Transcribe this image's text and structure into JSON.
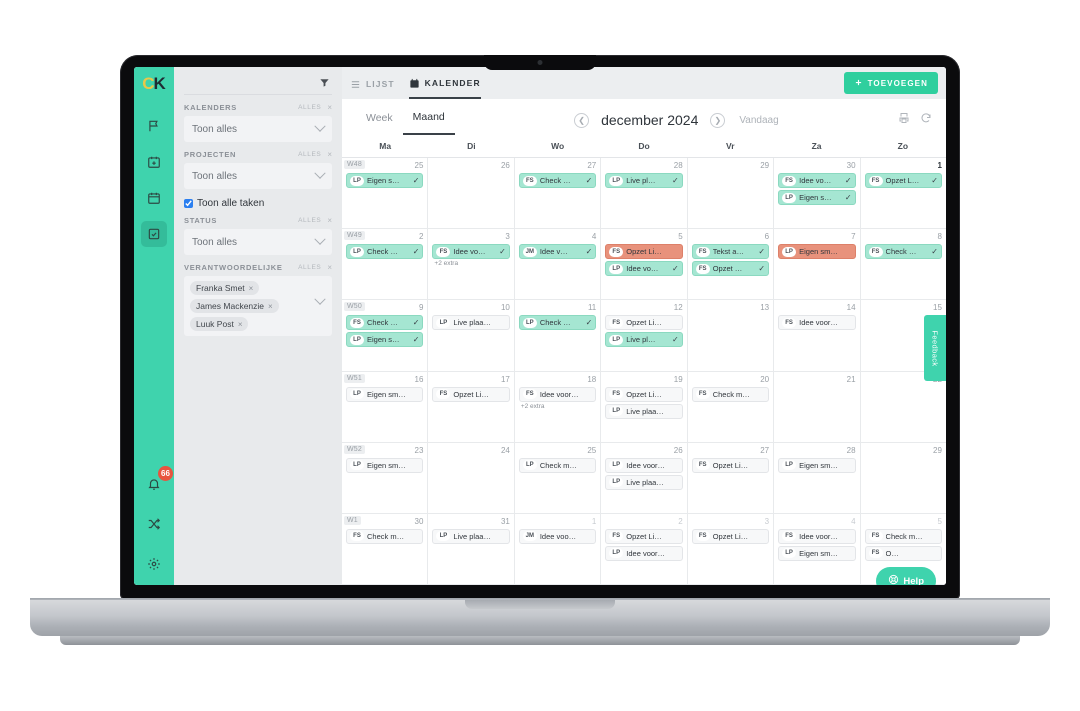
{
  "app": {
    "logo_c": "C",
    "logo_k": "K"
  },
  "rail": {
    "items": [
      {
        "name": "flag-icon",
        "label": "Vlag"
      },
      {
        "name": "calendar-plus-icon",
        "label": "Nieuwe agenda"
      },
      {
        "name": "calendar-icon",
        "label": "Agenda"
      },
      {
        "name": "checkbox-icon",
        "label": "Taken"
      }
    ],
    "bottom": [
      {
        "name": "bell-icon",
        "label": "Meldingen",
        "badge": "66"
      },
      {
        "name": "shuffle-icon",
        "label": "Wisselen"
      },
      {
        "name": "gear-icon",
        "label": "Instellingen"
      }
    ]
  },
  "filters": {
    "funnel_icon": "filter-icon",
    "groups": [
      {
        "label": "KALENDERS",
        "all": "ALLES",
        "clear": "×",
        "value": "Toon alles"
      },
      {
        "label": "PROJECTEN",
        "all": "ALLES",
        "clear": "×",
        "value": "Toon alles"
      }
    ],
    "checkbox": {
      "label": "Toon alle taken",
      "checked": true
    },
    "status": {
      "label": "STATUS",
      "all": "ALLES",
      "clear": "×",
      "value": "Toon alles"
    },
    "responsible": {
      "label": "VERANTWOORDELIJKE",
      "all": "ALLES",
      "clear": "×",
      "tags": [
        "Franka Smet",
        "James Mackenzie",
        "Luuk Post"
      ],
      "tag_remove": "×"
    }
  },
  "topbar": {
    "tabs": [
      {
        "label": "LIJST",
        "icon": "list-icon",
        "active": false
      },
      {
        "label": "KALENDER",
        "icon": "calendar-icon",
        "active": true
      }
    ],
    "add_label": "TOEVOEGEN",
    "add_icon": "plus-icon"
  },
  "calbar": {
    "views": [
      {
        "label": "Week",
        "active": false
      },
      {
        "label": "Maand",
        "active": true
      }
    ],
    "prev_icon": "chevron-left-icon",
    "next_icon": "chevron-right-icon",
    "title": "december 2024",
    "today_label": "Vandaag",
    "print_icon": "print-icon",
    "refresh_icon": "refresh-icon"
  },
  "calendar": {
    "day_headers": [
      "Ma",
      "Di",
      "Wo",
      "Do",
      "Vr",
      "Za",
      "Zo"
    ],
    "more_label": "+2 extra",
    "weeks": [
      {
        "week": "W48",
        "days": [
          {
            "num": "25",
            "dim": false,
            "bold": false,
            "events": [
              {
                "av": "LP",
                "text": "Eigen s…",
                "state": "done",
                "check": true
              }
            ]
          },
          {
            "num": "26",
            "dim": false,
            "bold": false,
            "events": []
          },
          {
            "num": "27",
            "dim": false,
            "bold": false,
            "events": [
              {
                "av": "FS",
                "text": "Check …",
                "state": "done",
                "check": true
              }
            ]
          },
          {
            "num": "28",
            "dim": false,
            "bold": false,
            "events": [
              {
                "av": "LP",
                "text": "Live pl…",
                "state": "done",
                "check": true
              }
            ]
          },
          {
            "num": "29",
            "dim": false,
            "bold": false,
            "events": []
          },
          {
            "num": "30",
            "dim": false,
            "bold": false,
            "events": [
              {
                "av": "FS",
                "text": "Idee vo…",
                "state": "done",
                "check": true
              },
              {
                "av": "LP",
                "text": "Eigen s…",
                "state": "done",
                "check": true
              }
            ]
          },
          {
            "num": "1",
            "dim": false,
            "bold": true,
            "events": [
              {
                "av": "FS",
                "text": "Opzet L…",
                "state": "done",
                "check": true
              }
            ]
          }
        ]
      },
      {
        "week": "W49",
        "days": [
          {
            "num": "2",
            "dim": false,
            "bold": false,
            "events": [
              {
                "av": "LP",
                "text": "Check …",
                "state": "done",
                "check": true
              }
            ]
          },
          {
            "num": "3",
            "dim": false,
            "bold": false,
            "more": true,
            "events": [
              {
                "av": "FS",
                "text": "Idee vo…",
                "state": "done",
                "check": true
              }
            ]
          },
          {
            "num": "4",
            "dim": false,
            "bold": false,
            "events": [
              {
                "av": "JM",
                "text": "Idee v…",
                "state": "done",
                "check": true
              }
            ]
          },
          {
            "num": "5",
            "dim": false,
            "bold": false,
            "events": [
              {
                "av": "FS",
                "text": "Opzet Li…",
                "state": "late",
                "check": false
              },
              {
                "av": "LP",
                "text": "Idee vo…",
                "state": "done",
                "check": true
              }
            ]
          },
          {
            "num": "6",
            "dim": false,
            "bold": false,
            "events": [
              {
                "av": "FS",
                "text": "Tekst a…",
                "state": "done",
                "check": true
              },
              {
                "av": "FS",
                "text": "Opzet …",
                "state": "done",
                "check": true
              }
            ]
          },
          {
            "num": "7",
            "dim": false,
            "bold": false,
            "events": [
              {
                "av": "LP",
                "text": "Eigen sm…",
                "state": "late",
                "check": false
              }
            ]
          },
          {
            "num": "8",
            "dim": false,
            "bold": false,
            "events": [
              {
                "av": "FS",
                "text": "Check …",
                "state": "done",
                "check": true
              }
            ]
          }
        ]
      },
      {
        "week": "W50",
        "days": [
          {
            "num": "9",
            "dim": false,
            "bold": false,
            "events": [
              {
                "av": "FS",
                "text": "Check …",
                "state": "done",
                "check": true
              },
              {
                "av": "LP",
                "text": "Eigen s…",
                "state": "done",
                "check": true
              }
            ]
          },
          {
            "num": "10",
            "dim": false,
            "bold": false,
            "events": [
              {
                "av": "LP",
                "text": "Live plaa…",
                "state": "open",
                "check": false
              }
            ]
          },
          {
            "num": "11",
            "dim": false,
            "bold": false,
            "events": [
              {
                "av": "LP",
                "text": "Check …",
                "state": "done",
                "check": true
              }
            ]
          },
          {
            "num": "12",
            "dim": false,
            "bold": false,
            "events": [
              {
                "av": "FS",
                "text": "Opzet Li…",
                "state": "open",
                "check": false
              },
              {
                "av": "LP",
                "text": "Live pl…",
                "state": "done",
                "check": true
              }
            ]
          },
          {
            "num": "13",
            "dim": false,
            "bold": false,
            "events": []
          },
          {
            "num": "14",
            "dim": false,
            "bold": false,
            "events": [
              {
                "av": "FS",
                "text": "Idee voor…",
                "state": "open",
                "check": false
              }
            ]
          },
          {
            "num": "15",
            "dim": false,
            "bold": false,
            "events": []
          }
        ]
      },
      {
        "week": "W51",
        "days": [
          {
            "num": "16",
            "dim": false,
            "bold": false,
            "events": [
              {
                "av": "LP",
                "text": "Eigen sm…",
                "state": "open",
                "check": false
              }
            ]
          },
          {
            "num": "17",
            "dim": false,
            "bold": false,
            "events": [
              {
                "av": "FS",
                "text": "Opzet Li…",
                "state": "open",
                "check": false
              }
            ]
          },
          {
            "num": "18",
            "dim": false,
            "bold": false,
            "more": true,
            "events": [
              {
                "av": "FS",
                "text": "Idee voor…",
                "state": "open",
                "check": false
              }
            ]
          },
          {
            "num": "19",
            "dim": false,
            "bold": false,
            "events": [
              {
                "av": "FS",
                "text": "Opzet Li…",
                "state": "open",
                "check": false
              },
              {
                "av": "LP",
                "text": "Live plaa…",
                "state": "open",
                "check": false
              }
            ]
          },
          {
            "num": "20",
            "dim": false,
            "bold": false,
            "events": [
              {
                "av": "FS",
                "text": "Check m…",
                "state": "open",
                "check": false
              }
            ]
          },
          {
            "num": "21",
            "dim": false,
            "bold": false,
            "events": []
          },
          {
            "num": "22",
            "dim": false,
            "bold": false,
            "events": []
          }
        ]
      },
      {
        "week": "W52",
        "days": [
          {
            "num": "23",
            "dim": false,
            "bold": false,
            "events": [
              {
                "av": "LP",
                "text": "Eigen sm…",
                "state": "open",
                "check": false
              }
            ]
          },
          {
            "num": "24",
            "dim": false,
            "bold": false,
            "events": []
          },
          {
            "num": "25",
            "dim": false,
            "bold": false,
            "events": [
              {
                "av": "LP",
                "text": "Check m…",
                "state": "open",
                "check": false
              }
            ]
          },
          {
            "num": "26",
            "dim": false,
            "bold": false,
            "events": [
              {
                "av": "LP",
                "text": "Idee voor…",
                "state": "open",
                "check": false
              },
              {
                "av": "LP",
                "text": "Live plaa…",
                "state": "open",
                "check": false
              }
            ]
          },
          {
            "num": "27",
            "dim": false,
            "bold": false,
            "events": [
              {
                "av": "FS",
                "text": "Opzet Li…",
                "state": "open",
                "check": false
              }
            ]
          },
          {
            "num": "28",
            "dim": false,
            "bold": false,
            "events": [
              {
                "av": "LP",
                "text": "Eigen sm…",
                "state": "open",
                "check": false
              }
            ]
          },
          {
            "num": "29",
            "dim": false,
            "bold": false,
            "events": []
          }
        ]
      },
      {
        "week": "W1",
        "days": [
          {
            "num": "30",
            "dim": false,
            "bold": false,
            "events": [
              {
                "av": "FS",
                "text": "Check m…",
                "state": "open",
                "check": false
              }
            ]
          },
          {
            "num": "31",
            "dim": false,
            "bold": false,
            "events": [
              {
                "av": "LP",
                "text": "Live plaa…",
                "state": "open",
                "check": false
              }
            ]
          },
          {
            "num": "1",
            "dim": true,
            "bold": false,
            "events": [
              {
                "av": "JM",
                "text": "Idee voo…",
                "state": "open",
                "check": false
              }
            ]
          },
          {
            "num": "2",
            "dim": true,
            "bold": false,
            "events": [
              {
                "av": "FS",
                "text": "Opzet Li…",
                "state": "open",
                "check": false
              },
              {
                "av": "LP",
                "text": "Idee voor…",
                "state": "open",
                "check": false
              }
            ]
          },
          {
            "num": "3",
            "dim": true,
            "bold": false,
            "events": [
              {
                "av": "FS",
                "text": "Opzet Li…",
                "state": "open",
                "check": false
              }
            ]
          },
          {
            "num": "4",
            "dim": true,
            "bold": false,
            "events": [
              {
                "av": "FS",
                "text": "Idee voor…",
                "state": "open",
                "check": false
              },
              {
                "av": "LP",
                "text": "Eigen sm…",
                "state": "open",
                "check": false
              }
            ]
          },
          {
            "num": "5",
            "dim": true,
            "bold": false,
            "events": [
              {
                "av": "FS",
                "text": "Check m…",
                "state": "open",
                "check": false
              },
              {
                "av": "FS",
                "text": "O…",
                "state": "open",
                "check": false
              }
            ]
          }
        ]
      }
    ]
  },
  "feedback": {
    "label": "Feedback"
  },
  "help": {
    "label": "Help",
    "icon": "lifebuoy-icon"
  },
  "colors": {
    "brand": "#3fd3ad",
    "accent": "#2fcf9e",
    "done": "#a5e6d2",
    "late": "#e8927c",
    "badge": "#e8543f"
  }
}
